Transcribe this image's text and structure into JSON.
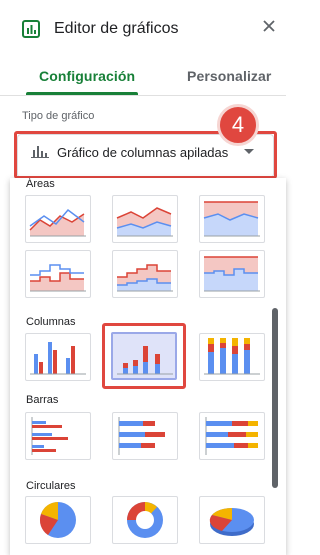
{
  "header": {
    "title": "Editor de gráficos",
    "chart_icon": "bar-chart-icon",
    "close_icon": "close-icon"
  },
  "tabs": [
    {
      "label": "Configuración",
      "active": true
    },
    {
      "label": "Personalizar",
      "active": false
    }
  ],
  "chart_type": {
    "label": "Tipo de gráfico",
    "selected": "Gráfico de columnas apiladas",
    "icon": "column-chart-icon"
  },
  "step_badge": "4",
  "dropdown": {
    "groups": [
      {
        "label": "Áreas",
        "items": [
          "area-chart",
          "stacked-area-chart",
          "100-stacked-area-chart",
          "stepped-area-chart",
          "stacked-stepped-area-chart",
          "100-stacked-stepped-area-chart"
        ]
      },
      {
        "label": "Columnas",
        "items": [
          "column-chart",
          "stacked-column-chart",
          "100-stacked-column-chart"
        ],
        "selected_index": 1
      },
      {
        "label": "Barras",
        "items": [
          "bar-chart",
          "stacked-bar-chart",
          "100-stacked-bar-chart"
        ]
      },
      {
        "label": "Circulares",
        "items": [
          "pie-chart",
          "donut-chart",
          "3d-pie-chart"
        ]
      }
    ]
  },
  "colors": {
    "accent_green": "#188038",
    "highlight_red": "#e0473f",
    "series_blue": "#5b8ff0",
    "series_red": "#db4437",
    "series_yellow": "#f4b400",
    "selection_bg": "#dfe3f9"
  }
}
